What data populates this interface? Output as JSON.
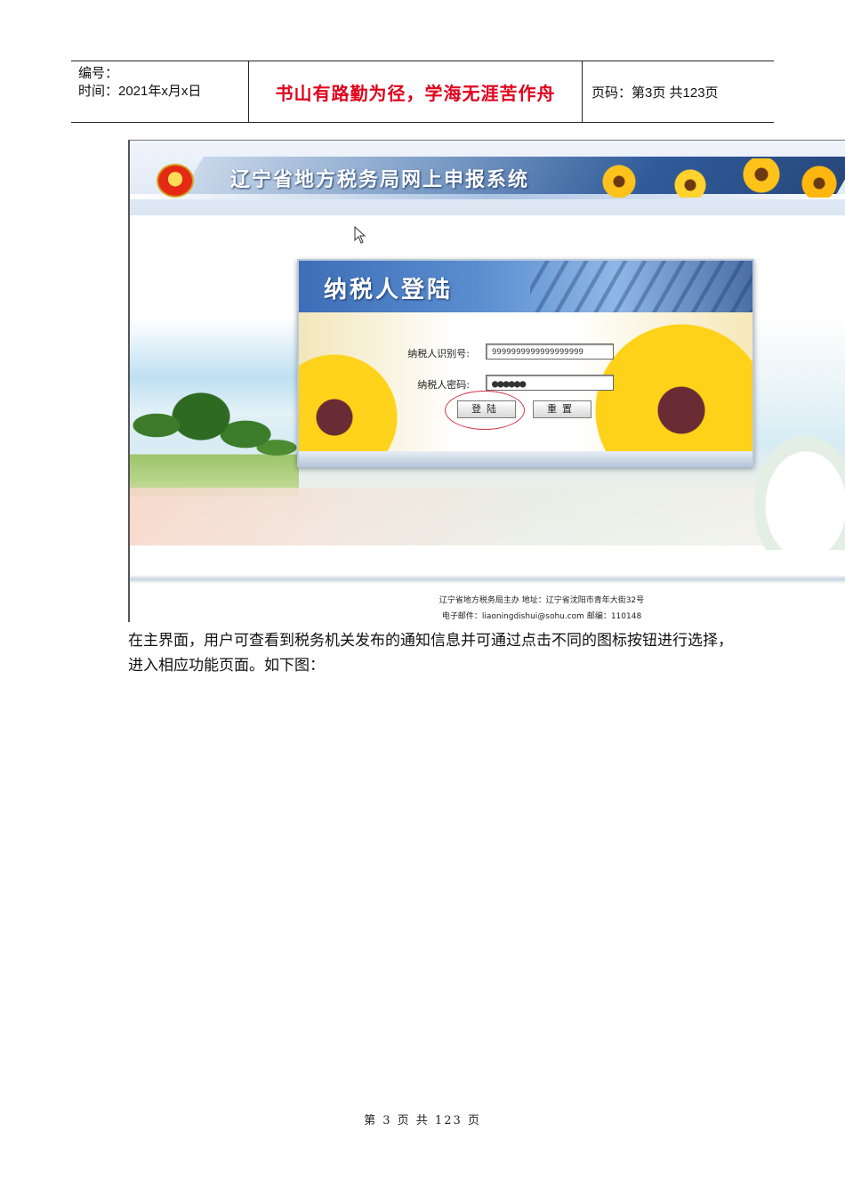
{
  "header": {
    "number_label": "编号：",
    "time_label": "时间：2021年x月x日",
    "motto": "书山有路勤为径，学海无涯苦作舟",
    "page_info": "页码：第3页  共123页"
  },
  "screenshot": {
    "banner_title": "辽宁省地方税务局网上申报系统",
    "login_panel": {
      "title": "纳税人登陆",
      "taxpayer_id_label": "纳税人识别号:",
      "taxpayer_id_value": "9999999999999999999",
      "password_label": "纳税人密码:",
      "password_value": "●●●●●●",
      "login_button": "登陆",
      "reset_button": "重置"
    },
    "footer_line1": "辽宁省地方税务局主办  地址：辽宁省沈阳市青年大街32号",
    "footer_line2": "电子邮件：liaoningdishui@sohu.com  邮编：110148"
  },
  "body": {
    "paragraph": "在主界面，用户可查看到税务机关发布的通知信息并可通过点击不同的图标按钮进行选择，进入相应功能页面。如下图："
  },
  "footer": {
    "page_number": "第 3 页 共 123 页"
  }
}
